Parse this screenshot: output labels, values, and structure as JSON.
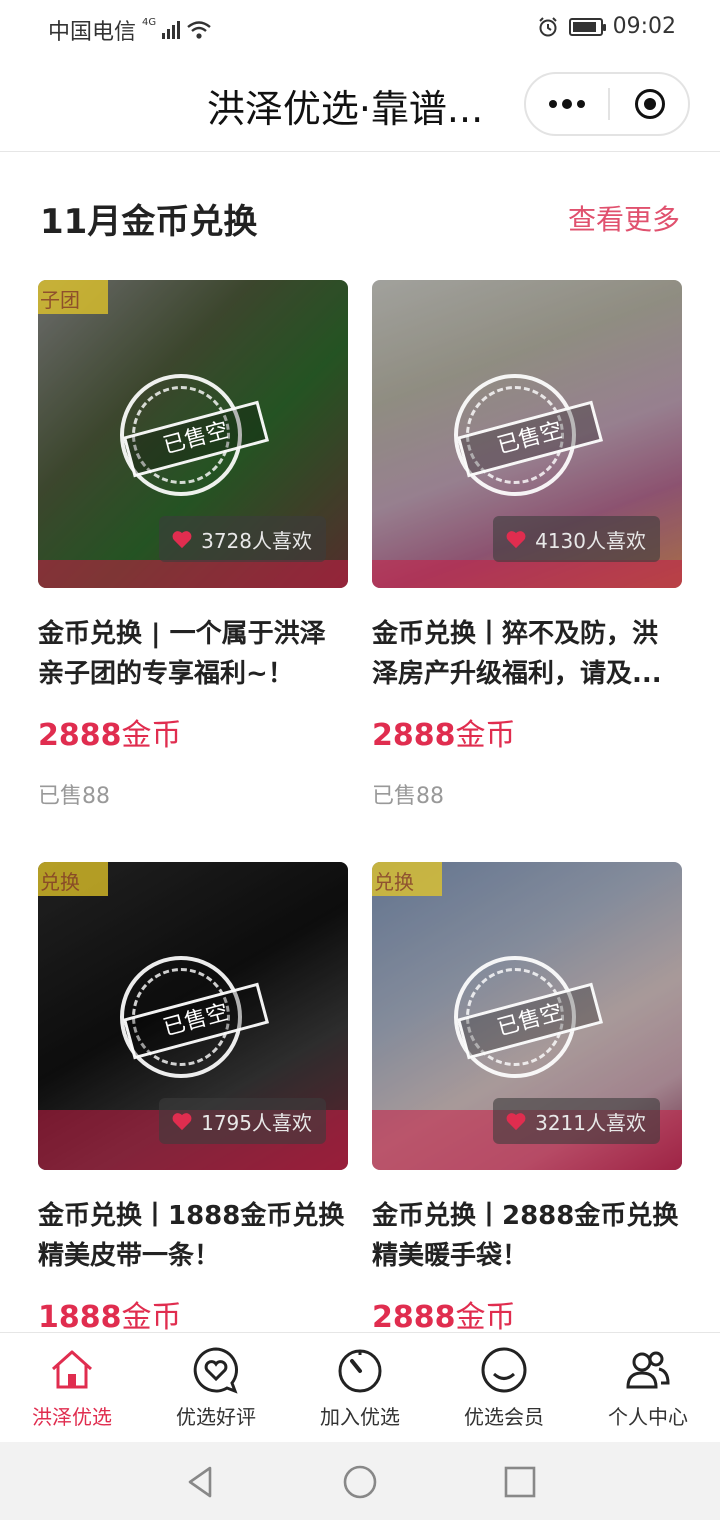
{
  "status_bar": {
    "carrier": "中国电信",
    "network": "4G",
    "time": "09:02",
    "battery_level": 0.9
  },
  "nav": {
    "title": "洪泽优选·靠谱..."
  },
  "section": {
    "title": "11月金币兑换",
    "view_more": "查看更多"
  },
  "products": [
    {
      "title": "金币兑换 | 一个属于洪泽亲子团的专享福利~！",
      "price_number": "2888",
      "price_unit": "金币",
      "likes": "3728人喜欢",
      "sold": "已售88",
      "sold_out_stamp": "已售空",
      "image_tag": "子团"
    },
    {
      "title": "金币兑换丨猝不及防，洪泽房产升级福利，请及...",
      "price_number": "2888",
      "price_unit": "金币",
      "likes": "4130人喜欢",
      "sold": "已售88",
      "sold_out_stamp": "已售空",
      "image_tag": ""
    },
    {
      "title": "金币兑换丨1888金币兑换精美皮带一条！",
      "price_number": "1888",
      "price_unit": "金币",
      "likes": "1795人喜欢",
      "sold": "",
      "sold_out_stamp": "已售空",
      "image_tag": "兑换"
    },
    {
      "title": "金币兑换丨2888金币兑换精美暖手袋！",
      "price_number": "2888",
      "price_unit": "金币",
      "likes": "3211人喜欢",
      "sold": "",
      "sold_out_stamp": "已售空",
      "image_tag": "兑换"
    }
  ],
  "tabs": [
    {
      "label": "洪泽优选",
      "icon": "home-icon",
      "active": true
    },
    {
      "label": "优选好评",
      "icon": "heart-chat-icon",
      "active": false
    },
    {
      "label": "加入优选",
      "icon": "timer-icon",
      "active": false
    },
    {
      "label": "优选会员",
      "icon": "smile-icon",
      "active": false
    },
    {
      "label": "个人中心",
      "icon": "users-icon",
      "active": false
    }
  ],
  "colors": {
    "accent": "#e02d4f",
    "view_more": "#e0516e"
  }
}
